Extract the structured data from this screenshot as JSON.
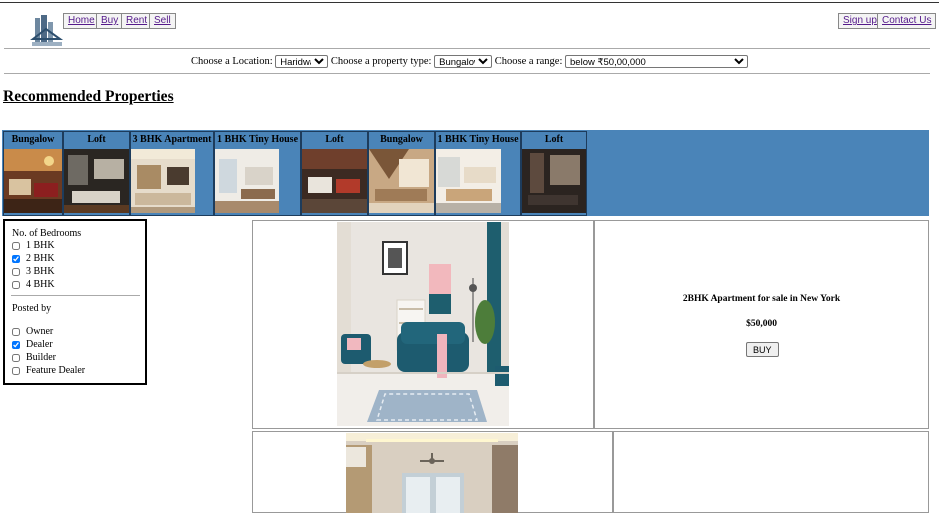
{
  "nav": {
    "left": [
      "Home",
      "Buy",
      "Rent",
      "Sell"
    ],
    "right": [
      "Sign up",
      "Contact Us"
    ]
  },
  "filters": {
    "location_label": "Choose a Location:",
    "location_value": "Haridwar",
    "type_label": "Choose a property type:",
    "type_value": "Bungalow",
    "range_label": "Choose a range:",
    "range_value": "below ₹50,00,000"
  },
  "recommended_title": "Recommended Properties",
  "carousel": [
    "Bungalow",
    "Loft",
    "3 BHK Apartment",
    "1 BHK Tiny House",
    "Loft",
    "Bungalow",
    "1 BHK Tiny House",
    "Loft"
  ],
  "sidebar": {
    "bedrooms_title": "No. of Bedrooms",
    "bedrooms": [
      {
        "label": "1 BHK",
        "checked": false
      },
      {
        "label": "2 BHK",
        "checked": true
      },
      {
        "label": "3 BHK",
        "checked": false
      },
      {
        "label": "4 BHK",
        "checked": false
      }
    ],
    "posted_title": "Posted by",
    "posted": [
      {
        "label": "Owner",
        "checked": false
      },
      {
        "label": "Dealer",
        "checked": true
      },
      {
        "label": "Builder",
        "checked": false
      },
      {
        "label": "Feature Dealer",
        "checked": false
      }
    ]
  },
  "listing": {
    "title": "2BHK Apartment for sale in New York",
    "price": "$50,000",
    "buy_label": "BUY"
  }
}
